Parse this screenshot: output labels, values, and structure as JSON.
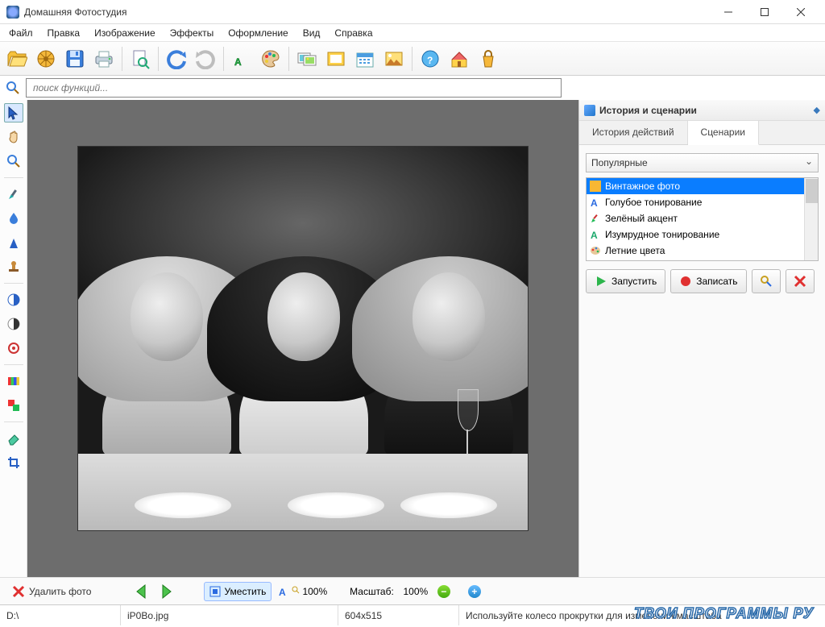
{
  "title": "Домашняя Фотостудия",
  "menu": [
    "Файл",
    "Правка",
    "Изображение",
    "Эффекты",
    "Оформление",
    "Вид",
    "Справка"
  ],
  "search_placeholder": "поиск функций...",
  "panel": {
    "header": "История и сценарии",
    "tab_history": "История действий",
    "tab_scen": "Сценарии",
    "dropdown": "Популярные",
    "items": [
      {
        "label": "Винтажное фото"
      },
      {
        "label": "Голубое тонирование"
      },
      {
        "label": "Зелёный акцент"
      },
      {
        "label": "Изумрудное тонирование"
      },
      {
        "label": "Летние цвета"
      }
    ],
    "run": "Запустить",
    "rec": "Записать"
  },
  "bottom": {
    "delete": "Удалить фото",
    "fit": "Уместить",
    "hundred": "100%",
    "scale_label": "Масштаб:",
    "scale_value": "100%"
  },
  "status": {
    "drive": "D:\\",
    "file": "iP0Bo.jpg",
    "dims": "604x515",
    "hint": "Используйте колесо прокрутки для изменения масштаба"
  },
  "watermark": "ТВОИ ПРОГРАММЫ РУ"
}
